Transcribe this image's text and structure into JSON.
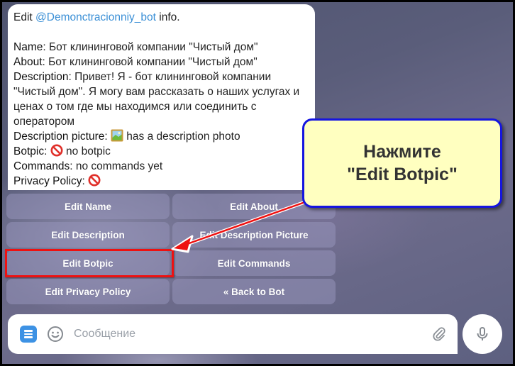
{
  "message": {
    "prefix": "Edit ",
    "mention": "@Demonctracionniy_bot",
    "suffix": " info.",
    "fields": [
      {
        "label": "Name",
        "value": ": Бот клининговой компании \"Чистый дом\""
      },
      {
        "label": "About",
        "value": ": Бот клининговой компании \"Чистый дом\""
      },
      {
        "label": "Description",
        "value": ": Привет! Я - бот клининговой компании \"Чистый дом\". Я могу вам рассказать о наших услугах и ценах о том где мы находимся или соединить с оператором"
      },
      {
        "label": "Description picture",
        "value": " has a description photo",
        "icon": "picture-icon"
      },
      {
        "label": "Botpic",
        "value": " no botpic",
        "icon": "prohibited-icon"
      },
      {
        "label": "Commands",
        "value": ": no commands yet"
      },
      {
        "label": "Privacy Policy",
        "value": "",
        "icon": "prohibited-icon"
      }
    ]
  },
  "keyboard": {
    "buttons": [
      {
        "label": "Edit Name"
      },
      {
        "label": "Edit About"
      },
      {
        "label": "Edit Description"
      },
      {
        "label": "Edit Description Picture"
      },
      {
        "label": "Edit Botpic"
      },
      {
        "label": "Edit Commands"
      },
      {
        "label": "Edit Privacy Policy"
      },
      {
        "label": "« Back to Bot"
      }
    ]
  },
  "callout": {
    "line1": "Нажмите",
    "line2": "\"Edit Botpic\""
  },
  "composer": {
    "placeholder": "Сообщение"
  },
  "colors": {
    "mention": "#3a8fd6",
    "highlight": "#ee1111",
    "callout_bg": "#ffffc0",
    "callout_border": "#1515e0",
    "menu_button": "#3d92e4"
  }
}
